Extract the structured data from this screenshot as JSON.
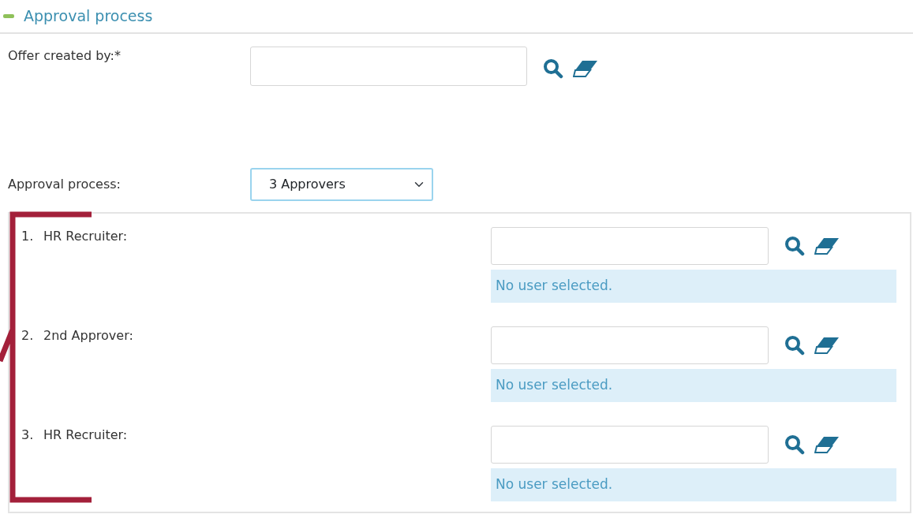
{
  "section": {
    "title": "Approval process",
    "expanded": true
  },
  "offer_created_by": {
    "label": "Offer created by:*"
  },
  "approval_process": {
    "label": "Approval process:",
    "value": "3 Approvers"
  },
  "approvers": [
    {
      "number": "1.",
      "label": "HR Recruiter:",
      "status": "No user selected."
    },
    {
      "number": "2.",
      "label": "2nd Approver:",
      "status": "No user selected."
    },
    {
      "number": "3.",
      "label": "HR Recruiter:",
      "status": "No user selected."
    }
  ]
}
